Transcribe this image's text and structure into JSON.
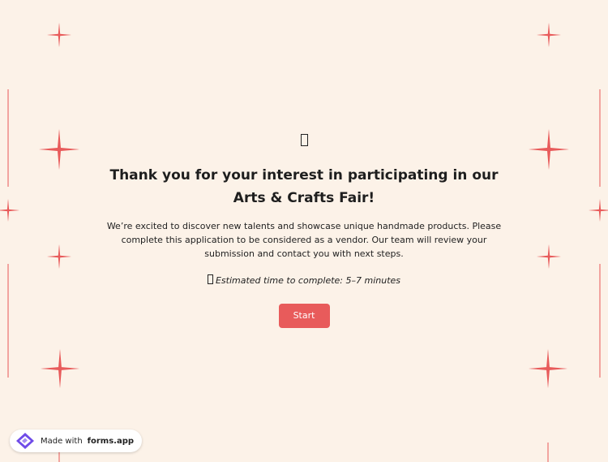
{
  "colors": {
    "background": "#fcf2e8",
    "accent": "#e85b5b",
    "sparkle": "#e85b5b",
    "logo_purple": "#6f4be8"
  },
  "welcome": {
    "icon": "emoji-icon",
    "title": "Thank you for your interest in participating in our Arts & Crafts Fair!",
    "description": "We’re excited to discover new talents and showcase unique handmade products. Please complete this application to be considered as a vendor. Our team will review your submission and contact you with next steps.",
    "time_icon": "clock-icon",
    "estimated_time": "Estimated time to complete: 5–7 minutes",
    "start_label": "Start"
  },
  "badge": {
    "prefix": "Made with",
    "brand": "forms.app",
    "logo_icon": "forms-app-logo-icon"
  }
}
